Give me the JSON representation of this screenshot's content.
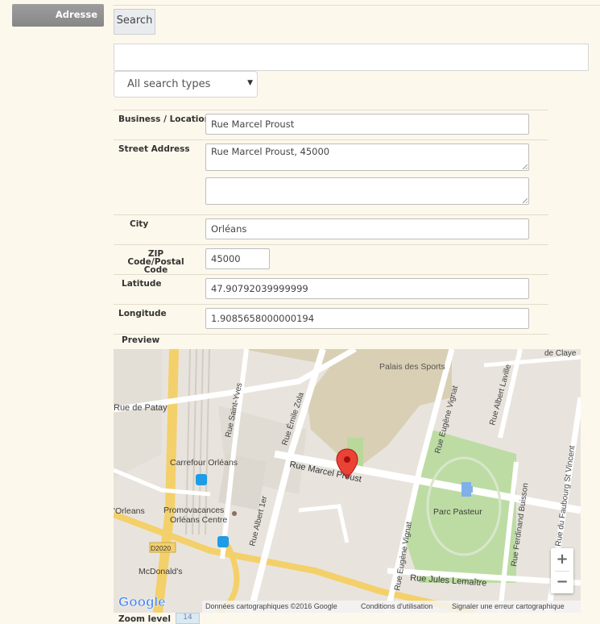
{
  "sidebar": {
    "tab_label": "Adresse"
  },
  "search": {
    "button_label": "Search",
    "query_value": "",
    "type_select": "All search types"
  },
  "form": {
    "business_location": {
      "label": "Business / Location",
      "value": "Rue Marcel Proust"
    },
    "street_address": {
      "label": "Street Address",
      "value_1": "Rue Marcel Proust, 45000",
      "value_2": ""
    },
    "city": {
      "label": "City",
      "value": "Orléans"
    },
    "zip": {
      "label": "ZIP Code/Postal Code",
      "label_line1": "ZIP Code/Postal",
      "label_line2": "Code",
      "value": "45000"
    },
    "latitude": {
      "label": "Latitude",
      "value": "47.90792039999999"
    },
    "longitude": {
      "label": "Longitude",
      "value": "1.9085658000000194"
    },
    "preview": {
      "label": "Preview"
    },
    "zoom_level": {
      "label": "Zoom level",
      "value": "14"
    }
  },
  "map": {
    "labels": {
      "palais": "Palais des Sports",
      "rue_de_patay": "Rue de Patay",
      "carrefour": "Carrefour Orléans",
      "orleans": "'Orleans",
      "promovacances_1": "Promovacances",
      "promovacances_2": "Orléans Centre",
      "mcdonalds": "McDonald's",
      "d2020": "D2020",
      "marcel_proust": "Rue Marcel Proust",
      "parc_pasteur": "Parc Pasteur",
      "jules_lemaitre": "Rue Jules Lemaître",
      "saint_yves": "Rue Saint-Yves",
      "emile_zola": "Rue Émile Zola",
      "albert_1er": "Rue Albert 1er",
      "eugene_vignat": "Rue Eugène Vignat",
      "albert_laville": "Rue Albert Laville",
      "ferdinand_buisson": "Rue Ferdinand Buisson",
      "faubourg": "Rue du Faubourg St Vincent",
      "claye": "de Claye"
    },
    "logo": "Google",
    "attribution": {
      "data": "Données cartographiques ©2016 Google",
      "terms": "Conditions d'utilisation",
      "report": "Signaler une erreur cartographique"
    },
    "zoom_in": "+",
    "zoom_out": "−"
  }
}
